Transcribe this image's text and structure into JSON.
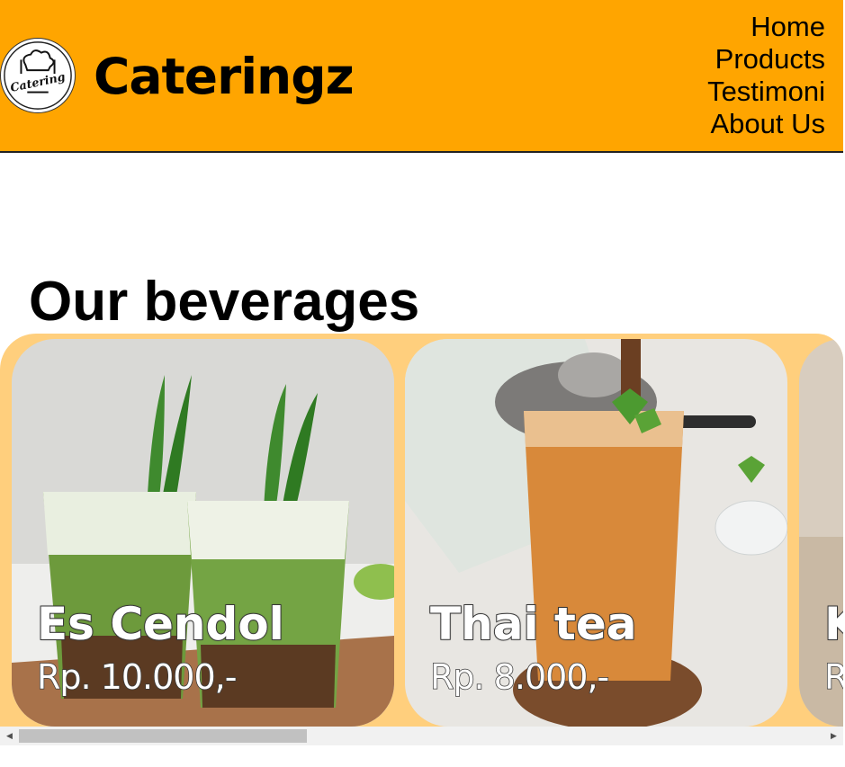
{
  "header": {
    "brand": "Cateringz",
    "logo_text": "Catering",
    "nav": [
      "Home",
      "Products",
      "Testimoni",
      "About Us"
    ]
  },
  "main": {
    "section_title": "Our beverages",
    "products": [
      {
        "name": "Es Cendol",
        "price": "Rp. 10.000,-"
      },
      {
        "name": "Thai tea",
        "price": "Rp. 8.000,-"
      },
      {
        "name": "K",
        "price": "R"
      }
    ]
  },
  "scrollbar": {
    "left_arrow": "◀",
    "right_arrow": "▶",
    "position": 0.0
  },
  "colors": {
    "header_bg": "#ffa500",
    "carousel_bg": "#ffcf7d"
  }
}
